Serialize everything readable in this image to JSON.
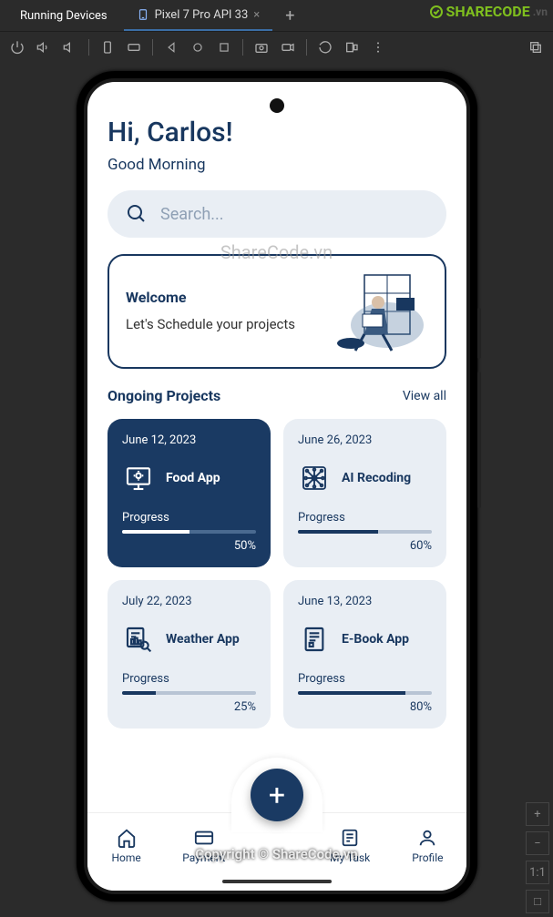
{
  "ide": {
    "tab_main": "Running Devices",
    "tab_device": "Pixel 7 Pro API 33"
  },
  "branding": {
    "logo": "SHARECODE",
    "logo_suffix": ".vn",
    "watermark_center": "ShareCode.vn",
    "watermark_bottom": "Copyright © ShareCode.vn"
  },
  "side_tools": {
    "plus": "+",
    "minus": "−",
    "ratio": "1:1",
    "square": "□"
  },
  "app": {
    "greeting": "Hi, Carlos!",
    "subgreeting": "Good Morning",
    "search_placeholder": "Search...",
    "welcome": {
      "title": "Welcome",
      "subtitle": "Let's Schedule your projects"
    },
    "ongoing": {
      "title": "Ongoing Projects",
      "view_all": "View all"
    },
    "projects": [
      {
        "date": "June 12, 2023",
        "name": "Food App",
        "progress_label": "Progress",
        "percent": 50,
        "percent_text": "50%",
        "dark": true
      },
      {
        "date": "June 26, 2023",
        "name": "AI Recoding",
        "progress_label": "Progress",
        "percent": 60,
        "percent_text": "60%",
        "dark": false
      },
      {
        "date": "July 22, 2023",
        "name": "Weather App",
        "progress_label": "Progress",
        "percent": 25,
        "percent_text": "25%",
        "dark": false
      },
      {
        "date": "June 13, 2023",
        "name": "E-Book App",
        "progress_label": "Progress",
        "percent": 80,
        "percent_text": "80%",
        "dark": false
      }
    ],
    "nav": {
      "home": "Home",
      "payment": "Payment",
      "mytask": "My Task",
      "profile": "Profile"
    },
    "fab": "+"
  }
}
